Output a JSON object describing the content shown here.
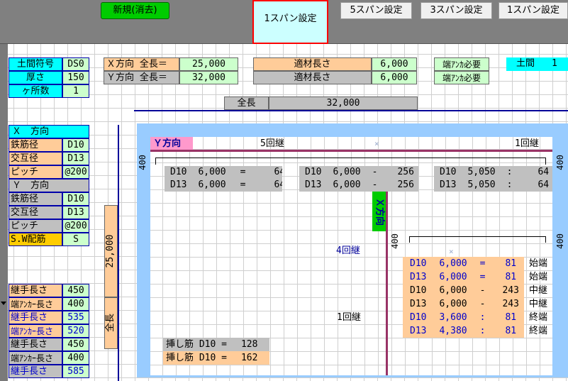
{
  "toolbar": {
    "new_button": "新規(消去)",
    "span1_active": "1スパン設定",
    "span5": "5スパン設定",
    "span3": "3スパン設定",
    "span1": "1スパン設定"
  },
  "slab": {
    "symbol_label": "土間符号",
    "symbol_value": "DS0",
    "thickness_label": "厚さ",
    "thickness_value": "150",
    "count_label": "ヶ所数",
    "count_value": "1"
  },
  "lengths": {
    "x_label": "Ｘ方向 全長＝",
    "x_value": "25,000",
    "y_label": "Ｙ方向 全長＝",
    "y_value": "32,000"
  },
  "material": {
    "label1": "適材長さ",
    "value1": "6,000",
    "label2": "適材長さ",
    "value2": "6,000"
  },
  "anchor": {
    "label1": "端ｱﾝｶ必要",
    "label2": "端ｱﾝｶ必要"
  },
  "doma": {
    "label": "土間",
    "value": "1"
  },
  "total": {
    "label": "全長",
    "value": "32,000"
  },
  "left_table": {
    "x_header": "Ｘ　方向",
    "x_rows": [
      {
        "label": "鉄筋径",
        "value": "D10"
      },
      {
        "label": "交互径",
        "value": "D13"
      },
      {
        "label": "ピッチ",
        "value": "@200"
      }
    ],
    "y_header": "Ｙ　方向",
    "y_rows": [
      {
        "label": "鉄筋径",
        "value": "D10"
      },
      {
        "label": "交互径",
        "value": "D13"
      },
      {
        "label": "ピッチ",
        "value": "@200"
      }
    ],
    "sw_label": "S.W配筋",
    "sw_value": "S",
    "joint_rows": [
      {
        "label": "継手長さ",
        "value": "450"
      },
      {
        "label": "端ｱﾝｶｰ長さ",
        "value": "400"
      },
      {
        "label": "継手長さ",
        "value": "535"
      },
      {
        "label": "端ｱﾝｶｰ長さ",
        "value": "520"
      },
      {
        "label": "継手長さ",
        "value": "450"
      },
      {
        "label": "端ｱﾝｶｰ長さ",
        "value": "400"
      },
      {
        "label": "継手長さ",
        "value": "585"
      }
    ]
  },
  "vertical_labels": {
    "dim": "25,000",
    "total": "全長"
  },
  "diagram": {
    "y_direction": "Ｙ方向",
    "x_direction": "Ｘ方向",
    "joints_5": "5回継",
    "joints_1_top": "1回継",
    "joints_4": "4回継",
    "joints_1_mid": "1回継",
    "dim_400_left": "400",
    "dim_400_right": "400",
    "dim_400_mid": "400",
    "dim_400_mid_right": "400",
    "marker": "×",
    "y_rows": [
      [
        "D10",
        "6,000",
        "=",
        "64"
      ],
      [
        "D13",
        "6,000",
        "=",
        "64"
      ]
    ],
    "y_rows_mid": [
      [
        "D10",
        "6,000",
        "-",
        "256"
      ],
      [
        "D13",
        "6,000",
        "-",
        "256"
      ]
    ],
    "y_rows_right": [
      [
        "D10",
        "5,050",
        ":",
        "64"
      ],
      [
        "D13",
        "5,050",
        ":",
        "64"
      ]
    ],
    "x_rows": [
      {
        "d": "D10",
        "len": "6,000",
        "op": "=",
        "n": "81",
        "pos": "始端"
      },
      {
        "d": "D13",
        "len": "6,000",
        "op": "=",
        "n": "81",
        "pos": "始端"
      },
      {
        "d": "D10",
        "len": "6,000",
        "op": "-",
        "n": "243",
        "pos": "中継"
      },
      {
        "d": "D13",
        "len": "6,000",
        "op": "-",
        "n": "243",
        "pos": "中継"
      },
      {
        "d": "D10",
        "len": "3,600",
        "op": ":",
        "n": "81",
        "pos": "終端"
      },
      {
        "d": "D13",
        "len": "4,380",
        "op": ":",
        "n": "81",
        "pos": "終端"
      }
    ],
    "insert1": {
      "label": "挿し筋 D10 =",
      "value": "128"
    },
    "insert2": {
      "label": "挿し筋 D10 =",
      "value": "162"
    }
  }
}
